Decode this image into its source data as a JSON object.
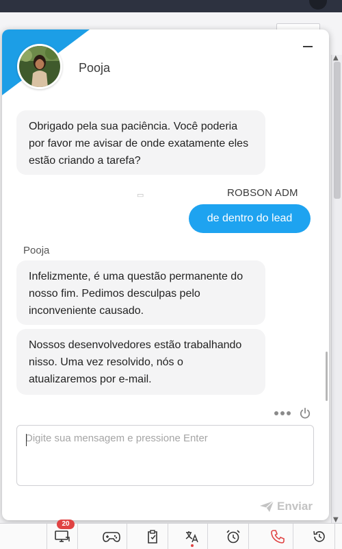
{
  "colors": {
    "accent": "#1c9ee6",
    "outgoing_bubble": "#1ea3f0",
    "incoming_bubble": "#f4f4f5",
    "badge": "#e04343",
    "phone_icon": "#e04343"
  },
  "chat": {
    "agent_name": "Pooja",
    "messages": [
      {
        "direction": "incoming",
        "text": "Obrigado pela sua paciência. Você poderia por favor me avisar de onde exatamente eles estão criando a tarefa?"
      },
      {
        "direction": "outgoing",
        "sender": "ROBSON ADM",
        "text": "de dentro do lead"
      },
      {
        "direction": "incoming",
        "sender": "Pooja",
        "text": "Infelizmente, é uma questão permanente do nosso fim. Pedimos desculpas pelo inconveniente causado."
      },
      {
        "direction": "incoming",
        "text": "Nossos desenvolvedores estão trabalhando nisso. Uma vez resolvido, nós o atualizaremos por e-mail."
      }
    ],
    "composer": {
      "placeholder": "Digite sua mensagem e pressione Enter",
      "value": ""
    },
    "send_label": "Enviar"
  },
  "toolbar": {
    "items": [
      {
        "icon": "screen-share-icon",
        "badge": "20"
      },
      {
        "icon": "gamepad-icon"
      },
      {
        "icon": "clipboard-icon"
      },
      {
        "icon": "translate-icon"
      },
      {
        "icon": "alarm-clock-icon"
      },
      {
        "icon": "phone-icon"
      },
      {
        "icon": "history-icon"
      }
    ]
  }
}
